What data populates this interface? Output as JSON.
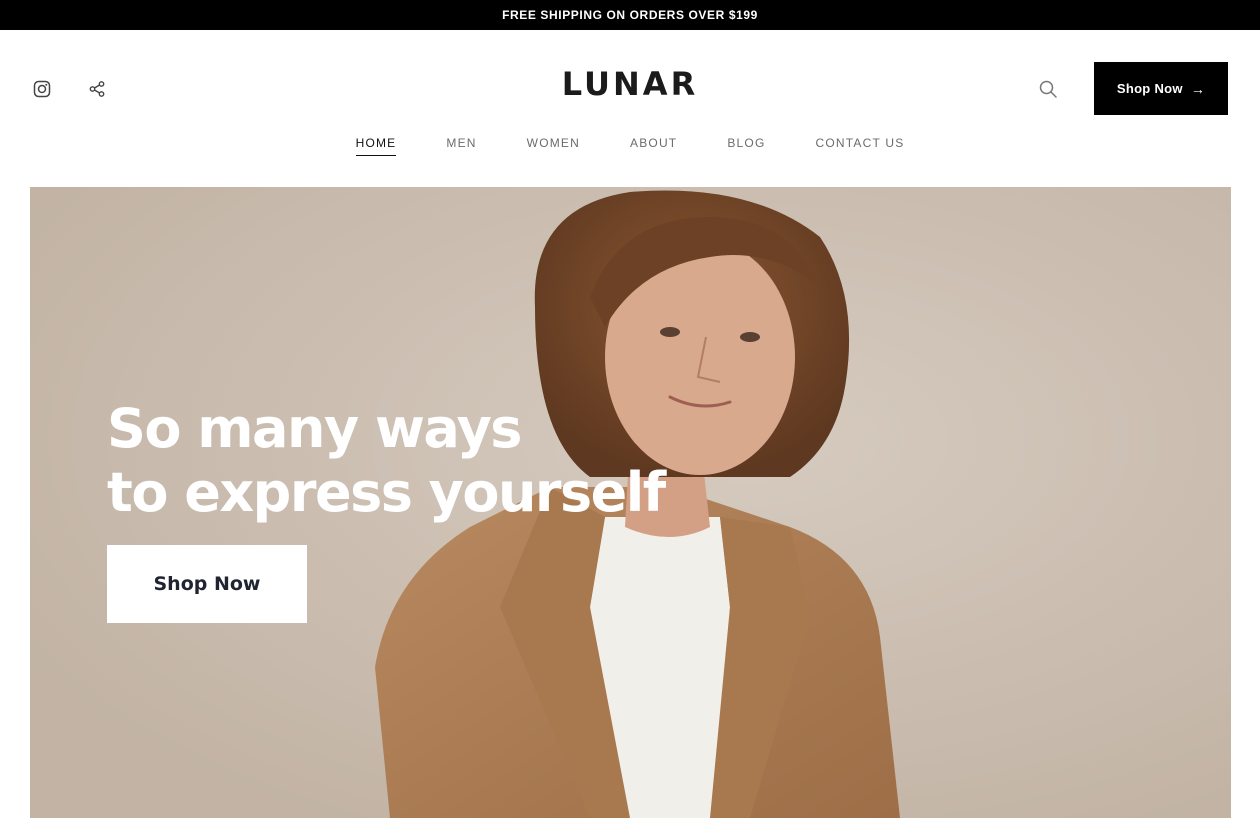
{
  "announcement": {
    "text": "FREE SHIPPING ON ORDERS OVER $199"
  },
  "header": {
    "logo": "LUNAR",
    "social_icons": [
      "instagram-icon",
      "share-icon"
    ],
    "search_icon": "search-icon",
    "cta_label": "Shop Now",
    "cta_arrow": "→"
  },
  "nav": {
    "items": [
      {
        "label": "HOME",
        "active": true
      },
      {
        "label": "MEN",
        "active": false
      },
      {
        "label": "WOMEN",
        "active": false
      },
      {
        "label": "ABOUT",
        "active": false
      },
      {
        "label": "BLOG",
        "active": false
      },
      {
        "label": "CONTACT US",
        "active": false
      }
    ]
  },
  "hero": {
    "title_line1": "So many ways",
    "title_line2": "to express yourself",
    "button_label": "Shop Now"
  },
  "colors": {
    "announcement_bg": "#000000",
    "cta_bg": "#000000",
    "hero_bg": "#cbbfb2",
    "coat": "#b07f55",
    "shirt": "#f2f0ec",
    "hair": "#7a4a2a",
    "skin": "#d8a88c"
  }
}
